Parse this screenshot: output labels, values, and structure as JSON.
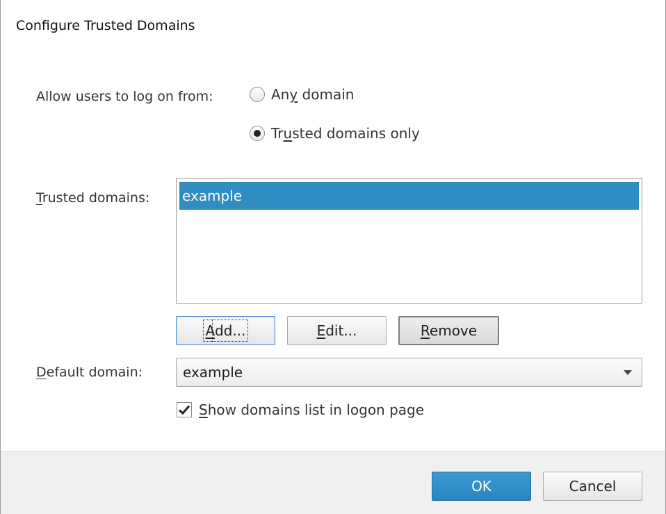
{
  "dialog": {
    "title": "Configure Trusted Domains"
  },
  "allow_logon": {
    "label_pre": "Allow users to log on from:",
    "options": [
      {
        "pre": "An",
        "key": "y",
        "post": " domain",
        "selected": false
      },
      {
        "pre": "Tr",
        "key": "u",
        "post": "sted domains only",
        "selected": true
      }
    ]
  },
  "trusted": {
    "label_key": "T",
    "label_post": "rusted domains:",
    "items": [
      "example"
    ],
    "selected_index": 0
  },
  "buttons": {
    "add_key": "A",
    "add_post": "dd...",
    "edit_key": "E",
    "edit_post": "dit...",
    "remove_key": "R",
    "remove_post": "emove"
  },
  "default_domain": {
    "label_key": "D",
    "label_post": "efault domain:",
    "value": "example"
  },
  "show_list": {
    "key": "S",
    "post": "how domains list in logon page",
    "checked": true
  },
  "footer": {
    "ok_label": "OK",
    "cancel_label": "Cancel"
  },
  "colors": {
    "accent": "#2f8dc2",
    "footer_bg": "#f0f0f0"
  }
}
